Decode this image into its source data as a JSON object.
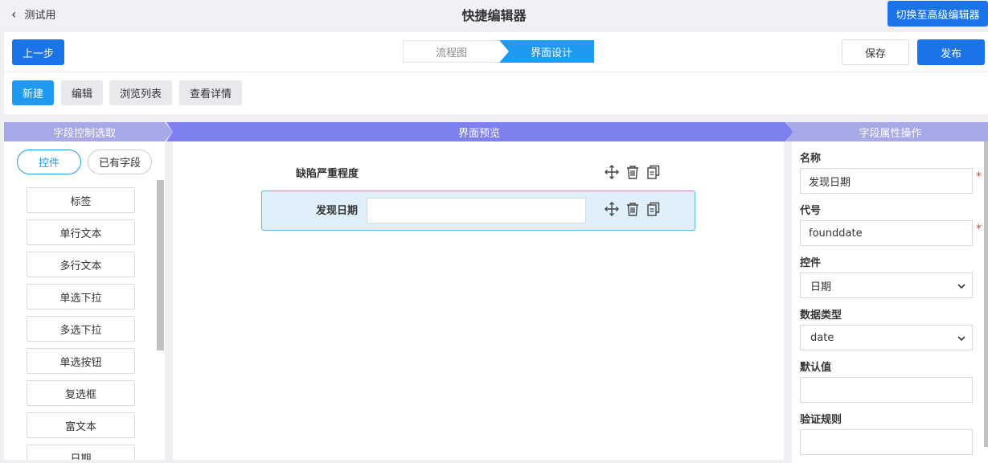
{
  "titlebar": {
    "back_label": "测试用",
    "title": "快捷编辑器",
    "switch_label": "切换至高级编辑器"
  },
  "toolbar": {
    "prev_label": "上一步",
    "steps": [
      "流程图",
      "界面设计"
    ],
    "save_label": "保存",
    "publish_label": "发布"
  },
  "actions": [
    "新建",
    "编辑",
    "浏览列表",
    "查看详情"
  ],
  "panels": {
    "left_title": "字段控制选取",
    "center_title": "界面预览",
    "right_title": "字段属性操作"
  },
  "left": {
    "tabs": [
      "控件",
      "已有字段"
    ],
    "controls": [
      "标签",
      "单行文本",
      "多行文本",
      "单选下拉",
      "多选下拉",
      "单选按钮",
      "复选框",
      "富文本",
      "日期"
    ]
  },
  "preview": {
    "rows": [
      {
        "label": "缺陷严重程度"
      },
      {
        "label": "发现日期"
      }
    ]
  },
  "properties": {
    "name_label": "名称",
    "name_value": "发现日期",
    "code_label": "代号",
    "code_value": "founddate",
    "control_label": "控件",
    "control_value": "日期",
    "datatype_label": "数据类型",
    "datatype_value": "date",
    "default_label": "默认值",
    "default_value": "",
    "validation_label": "验证规则",
    "validation_value": "",
    "required_mark": "*"
  },
  "colors": {
    "primary": "#1a73e8",
    "accent": "#1e9bf0",
    "panel_header": "#a6a8e8",
    "panel_header_center": "#7e80f0",
    "selected_row_bg": "#dff0fb"
  }
}
